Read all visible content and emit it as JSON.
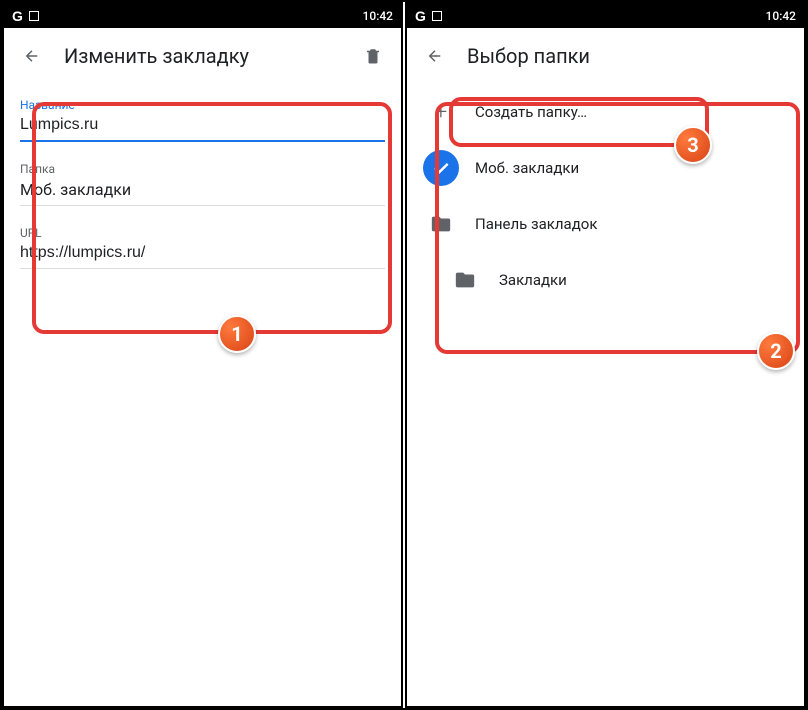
{
  "status": {
    "time": "10:42"
  },
  "left": {
    "title": "Изменить закладку",
    "fields": {
      "name_label": "Название",
      "name_value": "Lumpics.ru",
      "folder_label": "Папка",
      "folder_value": "Моб. закладки",
      "url_label": "URL",
      "url_value": "https://lumpics.ru/"
    }
  },
  "right": {
    "title": "Выбор папки",
    "items": {
      "create": "Создать папку…",
      "mobile": "Моб. закладки",
      "bar": "Панель закладок",
      "bookmarks": "Закладки"
    }
  },
  "badges": {
    "one": "1",
    "two": "2",
    "three": "3"
  }
}
